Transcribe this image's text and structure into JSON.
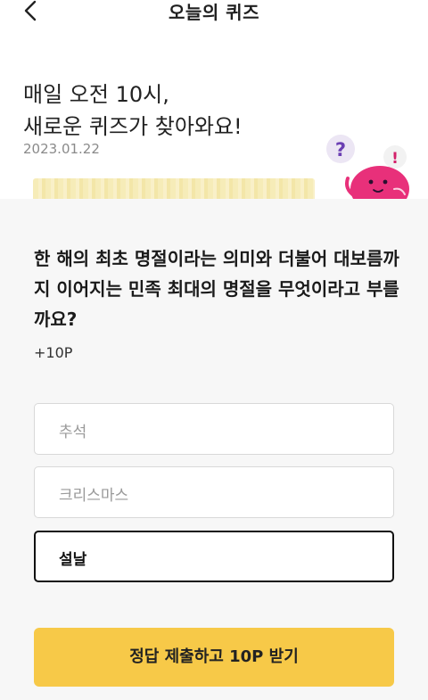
{
  "header": {
    "title": "오늘의 퀴즈",
    "back_icon": "chevron-left-icon"
  },
  "banner": {
    "headline": "매일 오전 10시,\n새로운 퀴즈가 찾아와요!",
    "date": "2023.01.22",
    "mascot_marks": {
      "question": "?",
      "exclaim": "!"
    }
  },
  "quiz": {
    "question": "한 해의 최초 명절이라는 의미와 더불어 대보름까지 이어지는 민족 최대의 명절을 무엇이라고 부를까요?",
    "points": "+10P",
    "options": [
      {
        "label": "추석",
        "selected": false
      },
      {
        "label": "크리스마스",
        "selected": false
      },
      {
        "label": "설날",
        "selected": true
      }
    ]
  },
  "submit": {
    "label": "정답 제출하고 10P 받기"
  },
  "colors": {
    "accent": "#f7c948",
    "mascot": "#e8307a",
    "content_bg": "#f7f7f7"
  }
}
